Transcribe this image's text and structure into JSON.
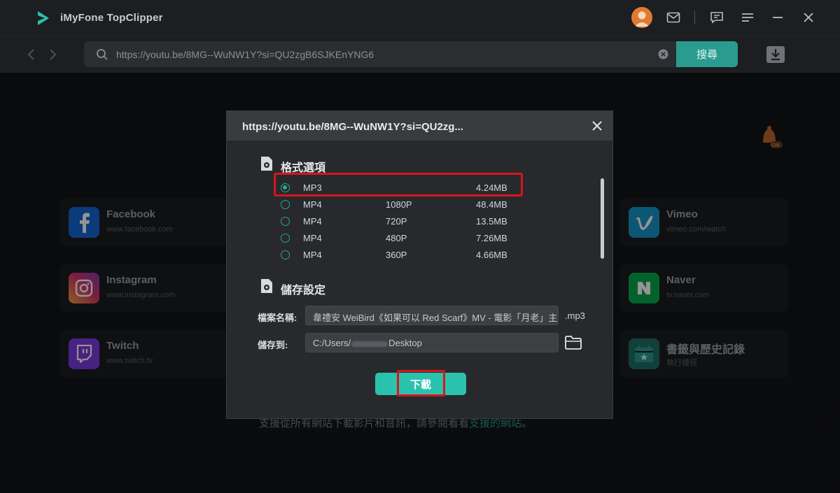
{
  "app": {
    "title": "iMyFone TopClipper"
  },
  "address_bar": {
    "url": "https://youtu.be/8MG--WuNW1Y?si=QU2zgB6SJKEnYNG6",
    "search_label": "搜尋"
  },
  "platforms": [
    {
      "name": "Facebook",
      "url": "www.facebook.com",
      "icon": "facebook-icon",
      "color": "#1877f2"
    },
    {
      "name": "Instagram",
      "url": "www.instagram.com",
      "icon": "instagram-icon",
      "color": "#c13584"
    },
    {
      "name": "Twitch",
      "url": "www.twitch.tv",
      "icon": "twitch-icon",
      "color": "#9146ff"
    },
    {
      "name": "Vimeo",
      "url": "vimeo.com/watch",
      "icon": "vimeo-icon",
      "color": "#1ab7ea"
    },
    {
      "name": "Naver",
      "url": "tv.naver.com",
      "icon": "naver-icon",
      "color": "#03c75a"
    },
    {
      "name": "書籤與歷史記錄",
      "url": "執行捷徑",
      "icon": "bookmark-icon",
      "color": "#2a9c8f"
    }
  ],
  "footer": {
    "text": "支援從所有網站下載影片和音訊，請參閱看看",
    "link": "支援的網站",
    "suffix": "。"
  },
  "modal": {
    "title": "https://youtu.be/8MG--WuNW1Y?si=QU2zg...",
    "format_section": "格式選項",
    "formats": [
      {
        "format": "MP3",
        "resolution": "",
        "size": "4.24MB",
        "selected": true
      },
      {
        "format": "MP4",
        "resolution": "1080P",
        "size": "48.4MB",
        "selected": false
      },
      {
        "format": "MP4",
        "resolution": "720P",
        "size": "13.5MB",
        "selected": false
      },
      {
        "format": "MP4",
        "resolution": "480P",
        "size": "7.26MB",
        "selected": false
      },
      {
        "format": "MP4",
        "resolution": "360P",
        "size": "4.66MB",
        "selected": false
      }
    ],
    "save_section": "儲存設定",
    "filename_label": "檔案名稱:",
    "filename_value": "韋禮安 WeiBird《如果可以 Red Scarf》MV - 電影「月老」主",
    "extension": ".mp3",
    "saveto_label": "儲存到:",
    "saveto_value_prefix": "C:/Users/",
    "saveto_value_suffix": "Desktop",
    "download_label": "下載"
  },
  "colors": {
    "accent": "#2a9c8f",
    "button": "#2bc2ad",
    "highlight": "#d6161d"
  }
}
